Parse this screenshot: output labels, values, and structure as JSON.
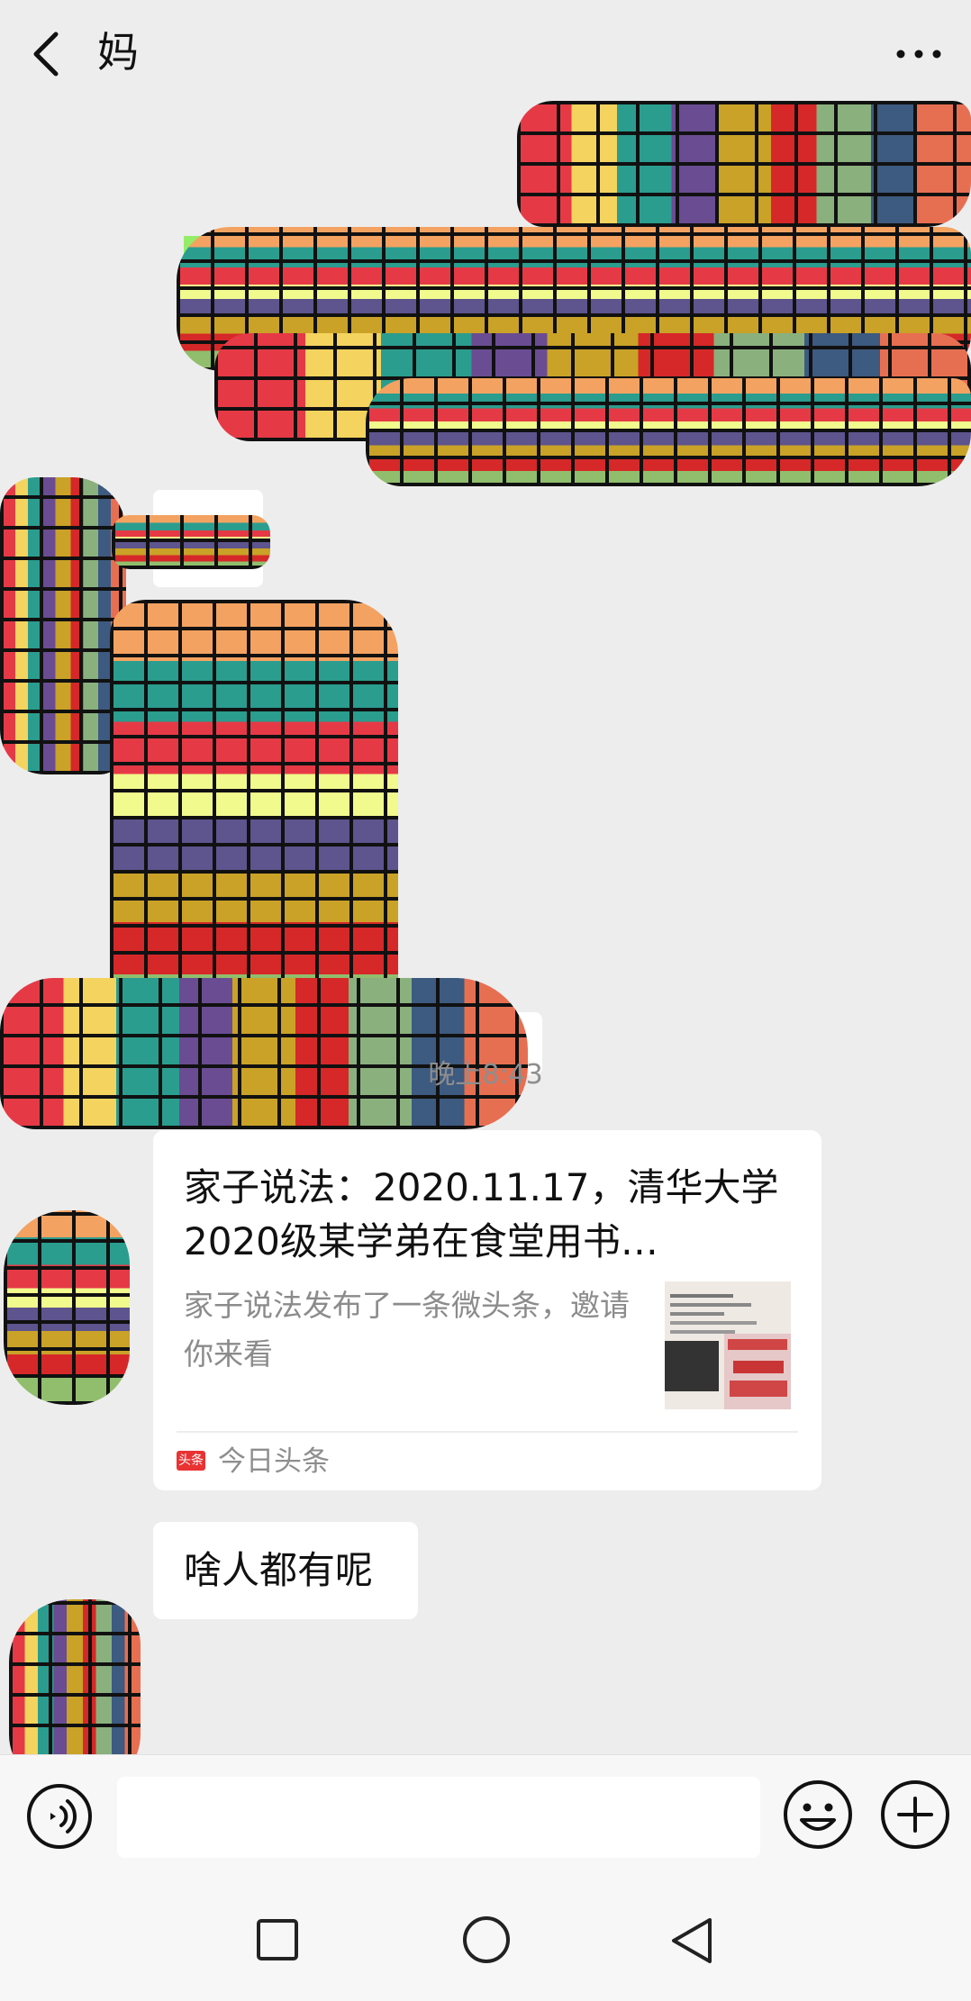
{
  "header": {
    "title": "妈"
  },
  "timestamp": "晚上8:43",
  "messages": {
    "card": {
      "title": "家子说法：2020.11.17，清华大学2020级某学弟在食堂用书…",
      "description": "家子说法发布了一条微头条，邀请你来看",
      "source_badge": "头条",
      "source": "今日头条"
    },
    "text": "啥人都有呢"
  },
  "icons": {
    "back": "back-chevron-icon",
    "more": "more-dots-icon",
    "voice": "voice-input-icon",
    "emoji": "emoji-icon",
    "plus": "plus-icon",
    "nav_square": "recent-apps-icon",
    "nav_circle": "home-icon",
    "nav_back": "nav-back-icon"
  }
}
